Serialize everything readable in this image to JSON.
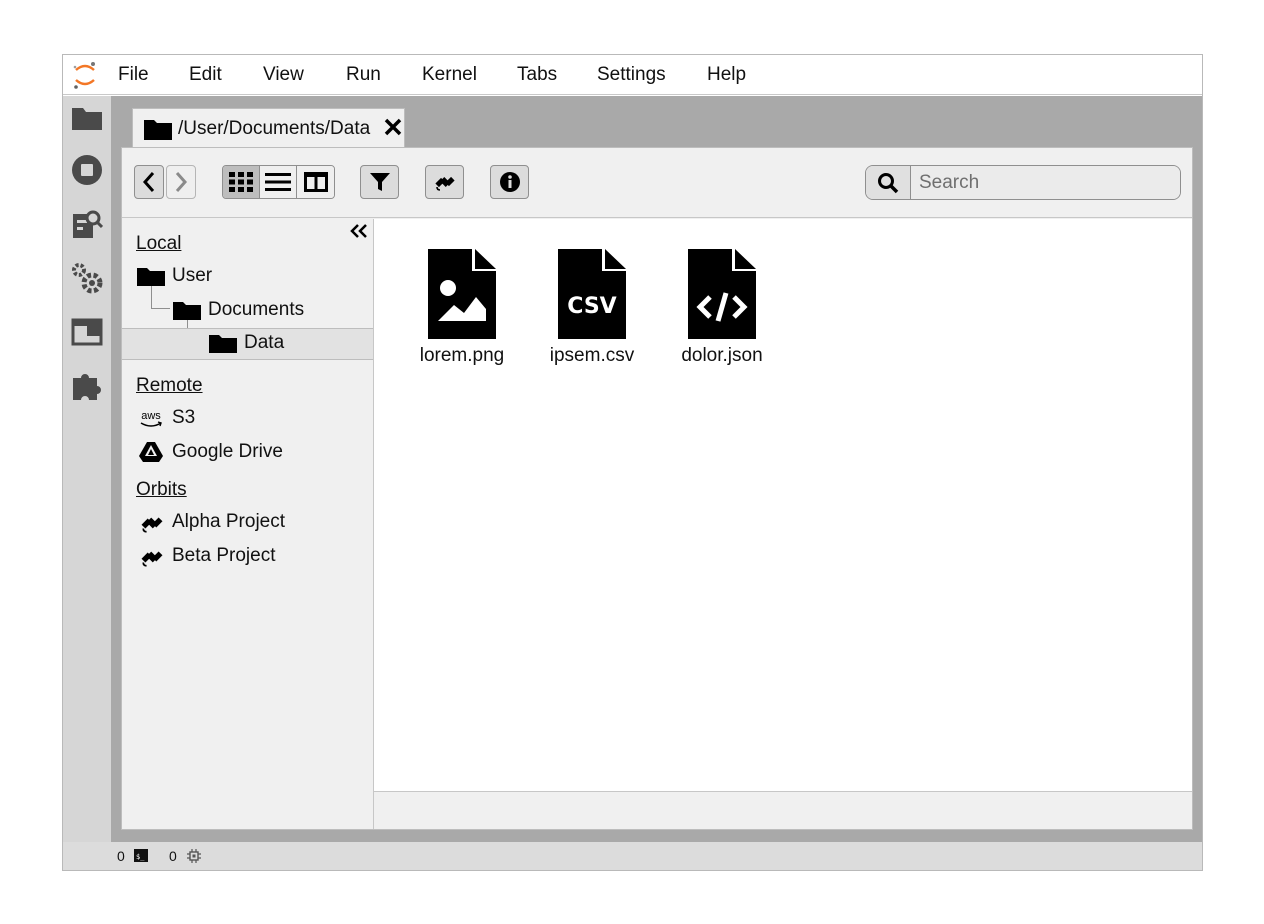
{
  "app": {
    "logo_icon": "jupyter-logo-icon",
    "accent_color": "#f37726"
  },
  "menu": {
    "items": [
      "File",
      "Edit",
      "View",
      "Run",
      "Kernel",
      "Tabs",
      "Settings",
      "Help"
    ]
  },
  "activity_bar": {
    "icons": [
      "folder-icon",
      "stop-circle-icon",
      "search-files-icon",
      "settings-gears-icon",
      "window-icon",
      "extension-puzzle-icon"
    ]
  },
  "tab": {
    "title": "/User/Documents/Data",
    "icon": "folder-icon",
    "close_icon": "close-icon"
  },
  "toolbar": {
    "back_icon": "chevron-left-icon",
    "forward_icon": "chevron-right-icon",
    "view_modes": [
      "grid-view-icon",
      "list-view-icon",
      "column-view-icon"
    ],
    "active_view": "grid-view-icon",
    "filter_icon": "filter-icon",
    "satellite_icon": "satellite-icon",
    "info_icon": "info-icon",
    "search_placeholder": "Search"
  },
  "sidebar": {
    "collapse_icon": "double-chevron-left-icon",
    "local": {
      "heading": "Local",
      "items": [
        {
          "label": "User",
          "icon": "folder-icon"
        },
        {
          "label": "Documents",
          "icon": "folder-icon"
        },
        {
          "label": "Data",
          "icon": "folder-icon",
          "selected": true
        }
      ]
    },
    "remote": {
      "heading": "Remote",
      "items": [
        {
          "label": "S3",
          "icon": "aws-icon"
        },
        {
          "label": "Google Drive",
          "icon": "google-drive-icon"
        }
      ]
    },
    "orbits": {
      "heading": "Orbits",
      "items": [
        {
          "label": "Alpha Project",
          "icon": "satellite-icon"
        },
        {
          "label": "Beta Project",
          "icon": "satellite-icon"
        }
      ]
    }
  },
  "files": [
    {
      "name": "lorem.png",
      "icon": "image-file-icon"
    },
    {
      "name": "ipsem.csv",
      "icon": "csv-file-icon"
    },
    {
      "name": "dolor.json",
      "icon": "code-file-icon"
    }
  ],
  "status_bar": {
    "terminals_count": "0",
    "terminal_icon": "terminal-icon",
    "kernels_count": "0",
    "kernel_icon": "kernel-chip-icon"
  }
}
